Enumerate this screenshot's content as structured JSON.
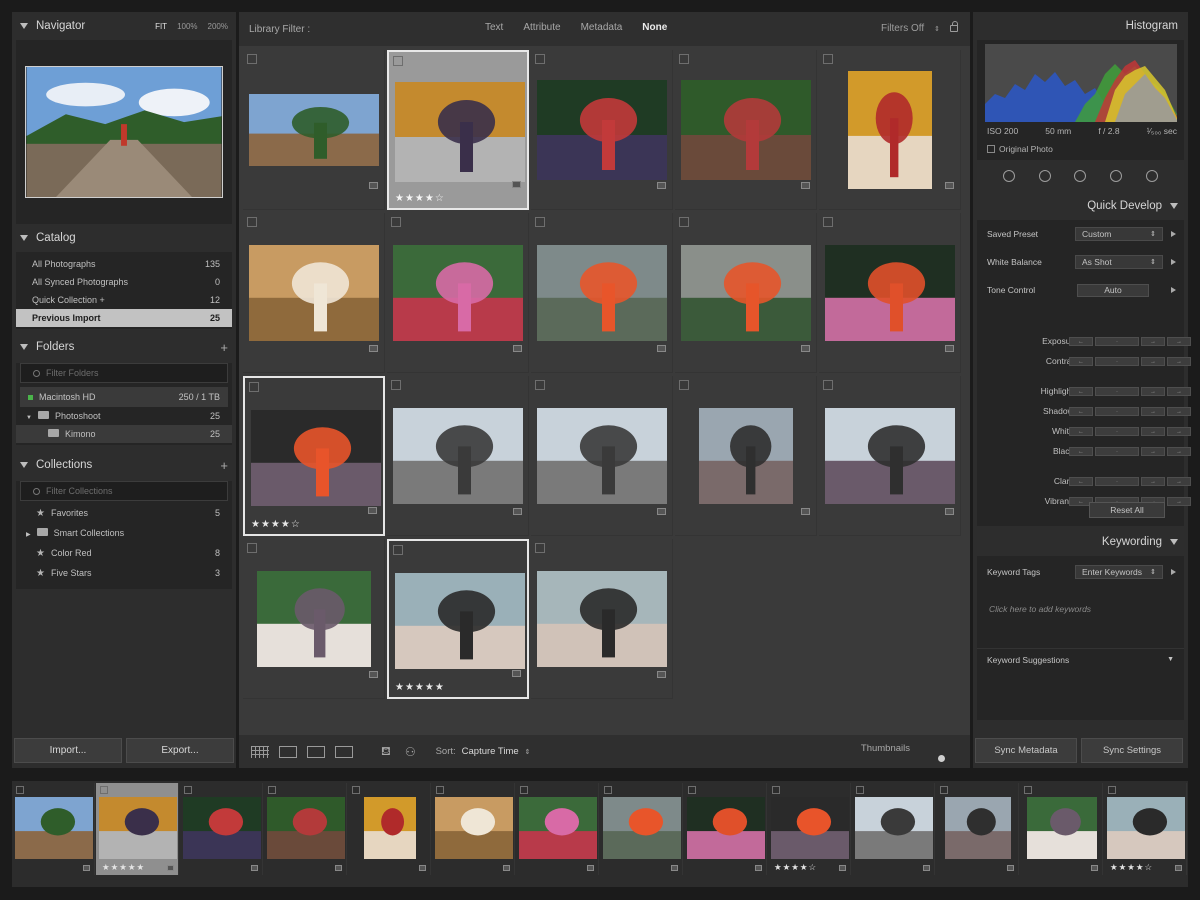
{
  "navigator": {
    "title": "Navigator",
    "zoom": [
      "FIT",
      "100%",
      "200%"
    ]
  },
  "catalog": {
    "title": "Catalog",
    "items": [
      {
        "label": "All Photographs",
        "count": "135"
      },
      {
        "label": "All Synced Photographs",
        "count": "0"
      },
      {
        "label": "Quick Collection +",
        "count": "12"
      },
      {
        "label": "Previous Import",
        "count": "25"
      }
    ]
  },
  "folders": {
    "title": "Folders",
    "filter_placeholder": "Filter Folders",
    "drive": {
      "label": "Macintosh HD",
      "usage": "250 / 1 TB"
    },
    "items": [
      {
        "label": "Photoshoot",
        "count": "25"
      },
      {
        "label": "Kimono",
        "count": "25"
      }
    ]
  },
  "collections": {
    "title": "Collections",
    "filter_placeholder": "Filter Collections",
    "items": [
      {
        "label": "Favorites",
        "count": "5"
      },
      {
        "label": "Smart Collections",
        "count": ""
      },
      {
        "label": "Color Red",
        "count": "8"
      },
      {
        "label": "Five Stars",
        "count": "3"
      }
    ]
  },
  "left_buttons": {
    "import": "Import...",
    "export": "Export..."
  },
  "library_filter": {
    "label": "Library Filter :",
    "tabs": [
      "Text",
      "Attribute",
      "Metadata",
      "None"
    ],
    "active_tab": "None",
    "filters_off": "Filters Off"
  },
  "grid": {
    "cells": [
      {
        "stars": "",
        "thumb": [
          "#7ea4d0",
          "#2f5d2a",
          "#8b6a4a"
        ]
      },
      {
        "stars": "★★★★☆",
        "thumb": [
          "#c48a2e",
          "#3a2f4a",
          "#b3b3b3"
        ]
      },
      {
        "stars": "",
        "thumb": [
          "#1f3b24",
          "#c23a3a",
          "#3b3556"
        ]
      },
      {
        "stars": "",
        "thumb": [
          "#2f5a2a",
          "#b33a3a",
          "#6a4a3a"
        ]
      },
      {
        "stars": "",
        "thumb": [
          "#d29a2a",
          "#b02a2a",
          "#e6d6c0"
        ]
      },
      {
        "stars": "",
        "thumb": [
          "#c89b62",
          "#efe6d6",
          "#8f6a3c"
        ]
      },
      {
        "stars": "",
        "thumb": [
          "#3b6a3a",
          "#d86aa6",
          "#b83a4a"
        ]
      },
      {
        "stars": "",
        "thumb": [
          "#7e8a8a",
          "#e8552a",
          "#5b6a5a"
        ]
      },
      {
        "stars": "",
        "thumb": [
          "#8a8f8a",
          "#e6552a",
          "#3b5a3a"
        ]
      },
      {
        "stars": "",
        "thumb": [
          "#1f2f22",
          "#e0502a",
          "#c26a9a"
        ]
      },
      {
        "stars": "★★★★☆",
        "thumb": [
          "#2a2a2a",
          "#e8542a",
          "#6a5a6a"
        ]
      },
      {
        "stars": "",
        "thumb": [
          "#c8d2da",
          "#3a3a3a",
          "#7a7a7a"
        ]
      },
      {
        "stars": "",
        "thumb": [
          "#c8d2da",
          "#3a3a3a",
          "#7a7a7a"
        ]
      },
      {
        "stars": "",
        "thumb": [
          "#9aa6b0",
          "#2f2f2f",
          "#7a6a6a"
        ]
      },
      {
        "stars": "",
        "thumb": [
          "#c8d2da",
          "#2f2f2f",
          "#6a5a6a"
        ]
      },
      {
        "stars": "",
        "thumb": [
          "#3a6a3a",
          "#6a5a6a",
          "#e6e0da"
        ]
      },
      {
        "stars": "★★★★★",
        "thumb": [
          "#9ab0b8",
          "#2a2a2a",
          "#d6c8be"
        ]
      },
      {
        "stars": "",
        "thumb": [
          "#a6b6ba",
          "#2a2a2a",
          "#d0c2b8"
        ]
      }
    ]
  },
  "toolbar": {
    "sort_label": "Sort:",
    "sort_value": "Capture Time",
    "thumbnails": "Thumbnails"
  },
  "histogram": {
    "title": "Histogram",
    "meta": [
      "ISO 200",
      "50 mm",
      "f / 2.8",
      "¹⁄₅₀₀ sec"
    ],
    "original": "Original Photo"
  },
  "quick_develop": {
    "title": "Quick Develop",
    "saved_preset": {
      "label": "Saved Preset",
      "value": "Custom"
    },
    "white_balance": {
      "label": "White Balance",
      "value": "As Shot"
    },
    "tone_control": {
      "label": "Tone Control",
      "button": "Auto"
    },
    "adjustments": [
      "Exposure",
      "Contrast",
      "Highlights",
      "Shadows",
      "Whites",
      "Blacks",
      "Clarity",
      "Vibrance"
    ],
    "reset": "Reset All"
  },
  "keywording": {
    "title": "Keywording",
    "tags_label": "Keyword Tags",
    "tags_value": "Enter Keywords",
    "hint": "Click here to add keywords",
    "suggestions": "Keyword Suggestions"
  },
  "right_buttons": {
    "sync_metadata": "Sync Metadata",
    "sync_settings": "Sync Settings"
  },
  "filmstrip": {
    "cells": [
      {
        "stars": "",
        "thumb": [
          "#7ea4d0",
          "#2f5d2a",
          "#8b6a4a"
        ]
      },
      {
        "stars": "★★★★★",
        "thumb": [
          "#c48a2e",
          "#3a2f4a",
          "#b3b3b3"
        ]
      },
      {
        "stars": "",
        "thumb": [
          "#1f3b24",
          "#c23a3a",
          "#3b3556"
        ]
      },
      {
        "stars": "",
        "thumb": [
          "#2f5a2a",
          "#b33a3a",
          "#6a4a3a"
        ]
      },
      {
        "stars": "",
        "thumb": [
          "#d29a2a",
          "#b02a2a",
          "#e6d6c0"
        ]
      },
      {
        "stars": "",
        "thumb": [
          "#c89b62",
          "#efe6d6",
          "#8f6a3c"
        ]
      },
      {
        "stars": "",
        "thumb": [
          "#3b6a3a",
          "#d86aa6",
          "#b83a4a"
        ]
      },
      {
        "stars": "",
        "thumb": [
          "#7e8a8a",
          "#e8552a",
          "#5b6a5a"
        ]
      },
      {
        "stars": "",
        "thumb": [
          "#1f2f22",
          "#e0502a",
          "#c26a9a"
        ]
      },
      {
        "stars": "★★★★☆",
        "thumb": [
          "#2a2a2a",
          "#e8542a",
          "#6a5a6a"
        ]
      },
      {
        "stars": "",
        "thumb": [
          "#c8d2da",
          "#3a3a3a",
          "#7a7a7a"
        ]
      },
      {
        "stars": "",
        "thumb": [
          "#9aa6b0",
          "#2f2f2f",
          "#7a6a6a"
        ]
      },
      {
        "stars": "",
        "thumb": [
          "#3a6a3a",
          "#6a5a6a",
          "#e6e0da"
        ]
      },
      {
        "stars": "★★★★☆",
        "thumb": [
          "#9ab0b8",
          "#2a2a2a",
          "#d6c8be"
        ]
      }
    ]
  }
}
